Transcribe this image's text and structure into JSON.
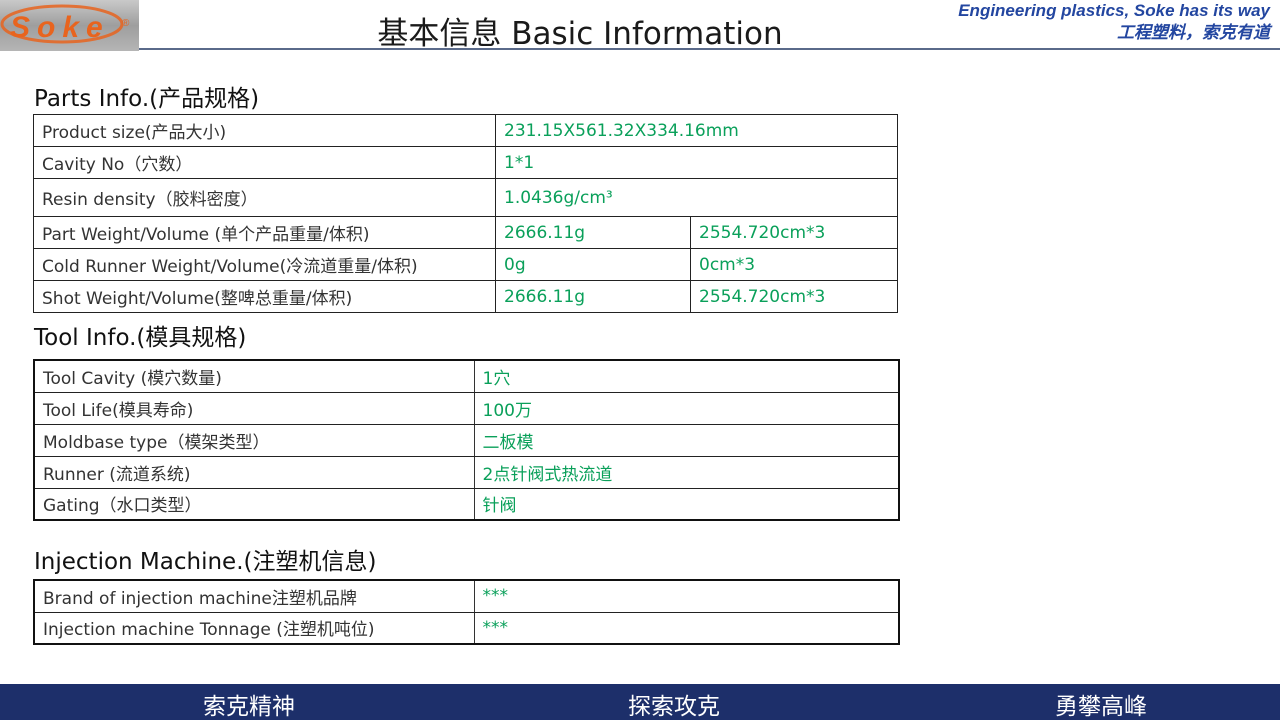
{
  "header": {
    "logo_text": "Soke",
    "title": "基本信息 Basic Information",
    "slogan_en": "Engineering plastics, Soke has its way",
    "slogan_cn": "工程塑料，索克有道"
  },
  "parts": {
    "title": "Parts Info.(产品规格)",
    "rows": [
      {
        "label": "Product size(产品大小)",
        "v1": "231.15X561.32X334.16mm"
      },
      {
        "label": "Cavity No（穴数）",
        "v1": "1*1"
      },
      {
        "label": "Resin density（胶料密度）",
        "v1": "1.0436g/cm³"
      },
      {
        "label": "Part Weight/Volume (单个产品重量/体积)",
        "v1": "2666.11g",
        "v2": "2554.720cm*3"
      },
      {
        "label": "Cold Runner Weight/Volume(冷流道重量/体积)",
        "v1": "0g",
        "v2": "0cm*3"
      },
      {
        "label": "Shot Weight/Volume(整啤总重量/体积)",
        "v1": "2666.11g",
        "v2": "2554.720cm*3"
      }
    ]
  },
  "tool": {
    "title": "Tool Info.(模具规格)",
    "rows": [
      {
        "label": "Tool Cavity (模穴数量)",
        "v1": "1穴"
      },
      {
        "label": "Tool Life(模具寿命)",
        "v1": "100万"
      },
      {
        "label": "Moldbase type（模架类型）",
        "v1": "二板模"
      },
      {
        "label": "Runner (流道系统)",
        "v1": "2点针阀式热流道"
      },
      {
        "label": "Gating（水口类型）",
        "v1": "针阀"
      }
    ]
  },
  "machine": {
    "title": "Injection Machine.(注塑机信息)",
    "rows": [
      {
        "label": "Brand of injection machine注塑机品牌",
        "v1": "***"
      },
      {
        "label": "Injection machine Tonnage (注塑机吨位)",
        "v1": "***"
      }
    ]
  },
  "footer": {
    "items": [
      "索克精神",
      "探索攻克",
      "勇攀高峰"
    ]
  },
  "colors": {
    "value_green": "#0aa05a",
    "footer_navy": "#1d2f6a",
    "slogan_blue": "#2346a0",
    "logo_orange": "#e8641e"
  }
}
